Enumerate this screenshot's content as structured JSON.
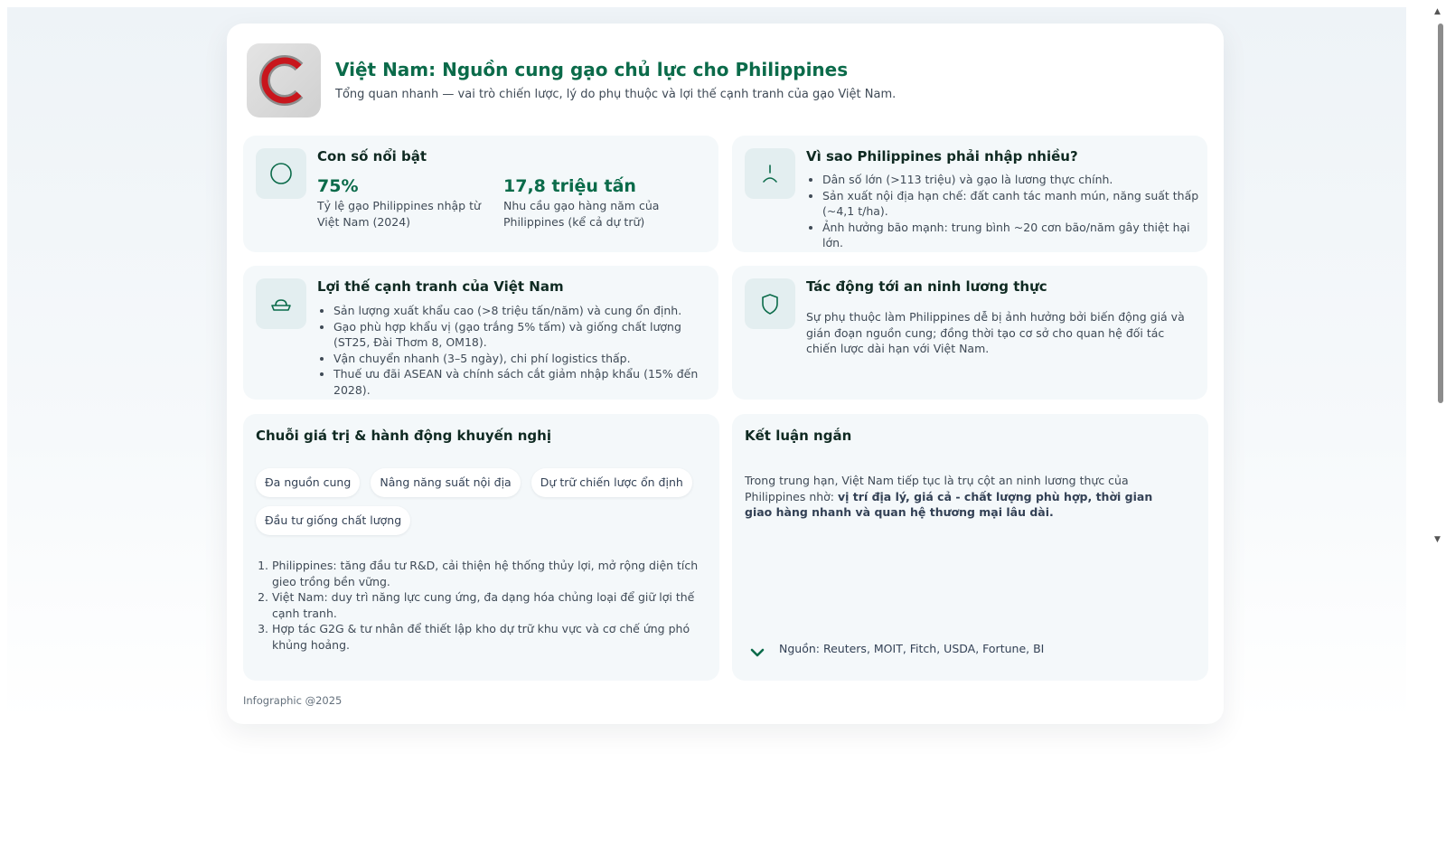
{
  "header": {
    "logo_icon": "c-logo-icon",
    "title": "Việt Nam: Nguồn cung gạo chủ lực cho Philippines",
    "subtitle": "Tổng quan nhanh — vai trò chiến lược, lý do phụ thuộc và lợi thế cạnh tranh của gạo Việt Nam."
  },
  "highlights": {
    "icon": "circle-icon",
    "title": "Con số nổi bật",
    "stats": [
      {
        "value": "75%",
        "label": "Tỷ lệ gạo Philippines nhập từ Việt Nam (2024)"
      },
      {
        "value": "17,8 triệu tấn",
        "label": "Nhu cầu gạo hàng năm của Philippines (kể cả dự trữ)"
      }
    ]
  },
  "why_import": {
    "icon": "alert-icon",
    "title": "Vì sao Philippines phải nhập nhiều?",
    "items": [
      "Dân số lớn (>113 triệu) và gạo là lương thực chính.",
      "Sản xuất nội địa hạn chế: đất canh tác manh mún, năng suất thấp (~4,1 t/ha).",
      "Ảnh hưởng bão mạnh: trung bình ~20 cơn bão/năm gây thiệt hại lớn."
    ]
  },
  "advantages": {
    "icon": "ship-icon",
    "title": "Lợi thế cạnh tranh của Việt Nam",
    "items": [
      "Sản lượng xuất khẩu cao (>8 triệu tấn/năm) và cung ổn định.",
      "Gạo phù hợp khẩu vị (gạo trắng 5% tấm) và giống chất lượng (ST25, Đài Thơm 8, OM18).",
      "Vận chuyển nhanh (3–5 ngày), chi phí logistics thấp.",
      "Thuế ưu đãi ASEAN và chính sách cắt giảm nhập khẩu (15% đến 2028)."
    ]
  },
  "impact": {
    "icon": "shield-icon",
    "title": "Tác động tới an ninh lương thực",
    "text": "Sự phụ thuộc làm Philippines dễ bị ảnh hưởng bởi biến động giá và gián đoạn nguồn cung; đồng thời tạo cơ sở cho quan hệ đối tác chiến lược dài hạn với Việt Nam."
  },
  "value_chain": {
    "title": "Chuỗi giá trị & hành động khuyến nghị",
    "chips": [
      "Đa nguồn cung",
      "Nâng năng suất nội địa",
      "Dự trữ chiến lược ổn định",
      "Đầu tư giống chất lượng"
    ],
    "actions": [
      "Philippines: tăng đầu tư R&D, cải thiện hệ thống thủy lợi, mở rộng diện tích gieo trồng bền vững.",
      "Việt Nam: duy trì năng lực cung ứng, đa dạng hóa chủng loại để giữ lợi thế cạnh tranh.",
      "Hợp tác G2G & tư nhân để thiết lập kho dự trữ khu vực và cơ chế ứng phó khủng hoảng."
    ]
  },
  "conclusion": {
    "title": "Kết luận ngắn",
    "text_plain": "Trong trung hạn, Việt Nam tiếp tục là trụ cột an ninh lương thực của Philippines nhờ:",
    "text_bold": "vị trí địa lý, giá cả - chất lượng phù hợp, thời gian giao hàng nhanh và quan hệ thương mại lâu dài.",
    "source_icon": "chevron-down-icon",
    "source": "Nguồn: Reuters, MOIT, Fitch, USDA, Fortune, BI"
  },
  "footer": "Infographic @2025",
  "colors": {
    "accent": "#0b6b4a",
    "panel_bg": "#f4f8fa",
    "icon_bg": "#e3eef0",
    "logo_red": "#c8161d"
  }
}
